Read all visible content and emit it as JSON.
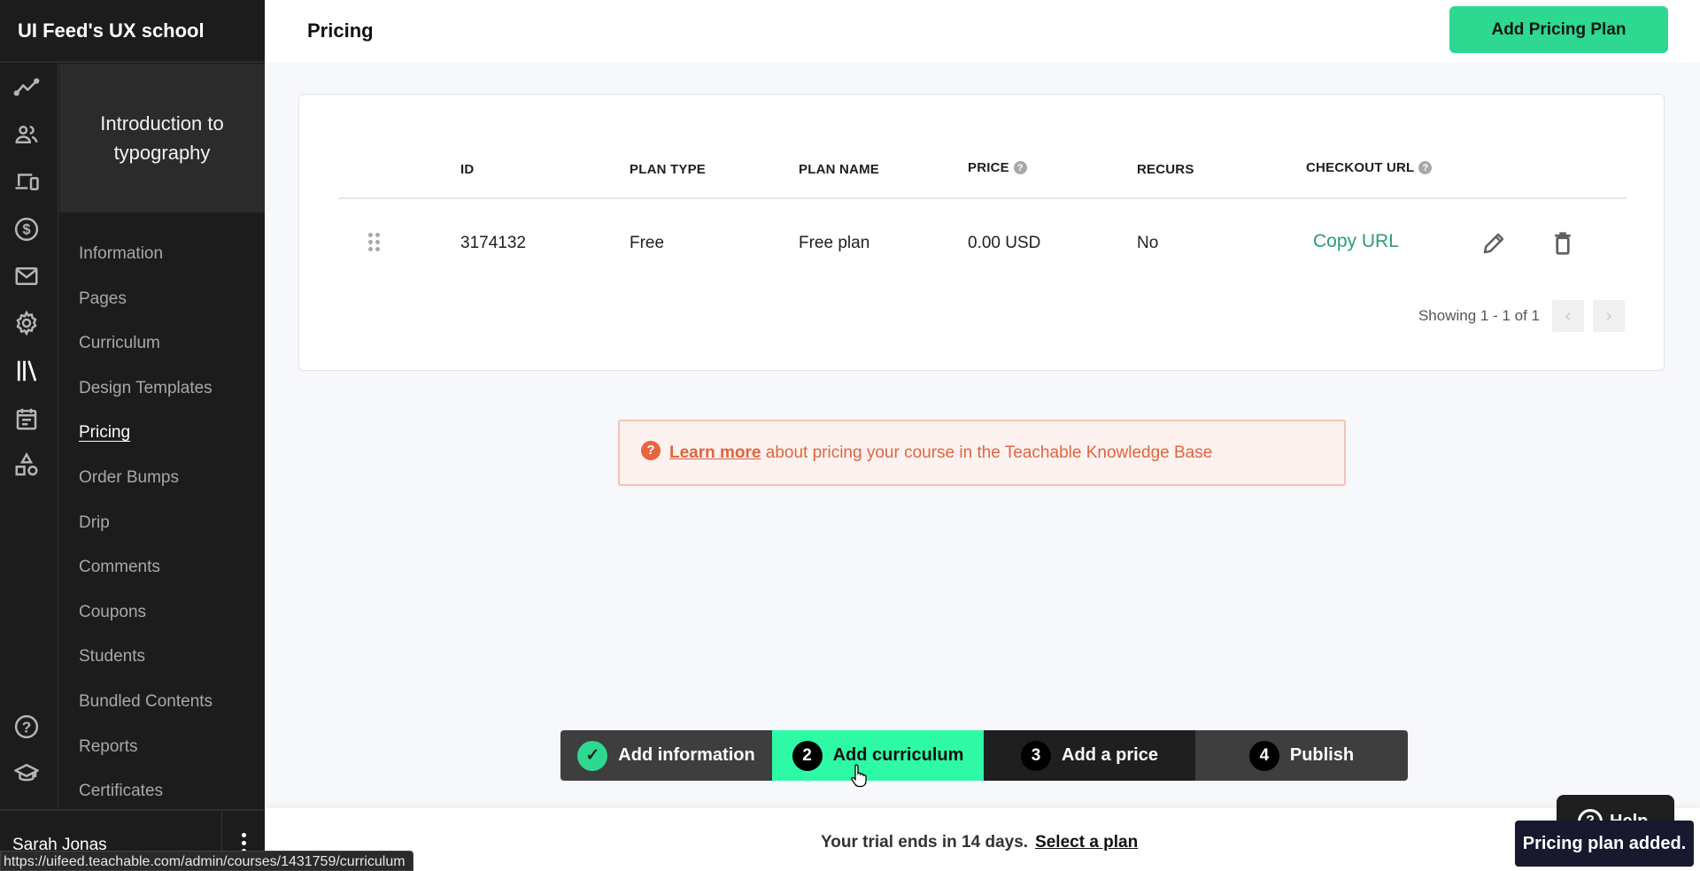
{
  "app": {
    "school_name": "UI Feed's UX school"
  },
  "rail_icons": [
    {
      "name": "analytics-icon"
    },
    {
      "name": "users-icon"
    },
    {
      "name": "devices-icon"
    },
    {
      "name": "dollar-icon"
    },
    {
      "name": "mail-icon"
    },
    {
      "name": "gear-icon"
    },
    {
      "name": "library-icon"
    },
    {
      "name": "calendar-icon"
    },
    {
      "name": "shapes-icon"
    },
    {
      "name": "help-icon"
    },
    {
      "name": "graduation-cap-icon"
    }
  ],
  "course": {
    "title": "Introduction to typography"
  },
  "nav": {
    "items": [
      {
        "label": "Information"
      },
      {
        "label": "Pages"
      },
      {
        "label": "Curriculum"
      },
      {
        "label": "Design Templates"
      },
      {
        "label": "Pricing",
        "active": true
      },
      {
        "label": "Order Bumps"
      },
      {
        "label": "Drip"
      },
      {
        "label": "Comments"
      },
      {
        "label": "Coupons"
      },
      {
        "label": "Students"
      },
      {
        "label": "Bundled Contents"
      },
      {
        "label": "Reports"
      },
      {
        "label": "Certificates"
      }
    ]
  },
  "user": {
    "name": "Sarah Jonas"
  },
  "header": {
    "title": "Pricing",
    "add_button": "Add Pricing Plan"
  },
  "table": {
    "columns": [
      "ID",
      "PLAN TYPE",
      "PLAN NAME",
      "PRICE",
      "RECURS",
      "CHECKOUT URL"
    ],
    "rows": [
      {
        "id": "3174132",
        "plan_type": "Free",
        "plan_name": "Free plan",
        "price": "0.00 USD",
        "recurs": "No",
        "checkout_url": "Copy URL"
      }
    ],
    "pagination": "Showing 1 - 1 of 1",
    "prev": "‹",
    "next": "›"
  },
  "info_banner": {
    "icon": "?",
    "link": "Learn more",
    "text": " about pricing your course in the Teachable Knowledge Base"
  },
  "stepper": {
    "steps": [
      {
        "num": "✓",
        "label": "Add information",
        "state": "done"
      },
      {
        "num": "2",
        "label": "Add curriculum",
        "state": "current"
      },
      {
        "num": "3",
        "label": "Add a price",
        "state": "todo"
      },
      {
        "num": "4",
        "label": "Publish",
        "state": "todo"
      }
    ]
  },
  "trial": {
    "text": "Your trial ends in 14 days.",
    "link": "Select a plan"
  },
  "help": {
    "icon": "?",
    "label": "Help"
  },
  "toast": {
    "message": "Pricing plan added."
  },
  "status_bar": {
    "url": "https://uifeed.teachable.com/admin/courses/1431759/curriculum"
  },
  "colors": {
    "accent": "#2ed891",
    "step_current": "#2efaa6",
    "link_green": "#2c9b7b",
    "info_orange": "#e0643e"
  }
}
